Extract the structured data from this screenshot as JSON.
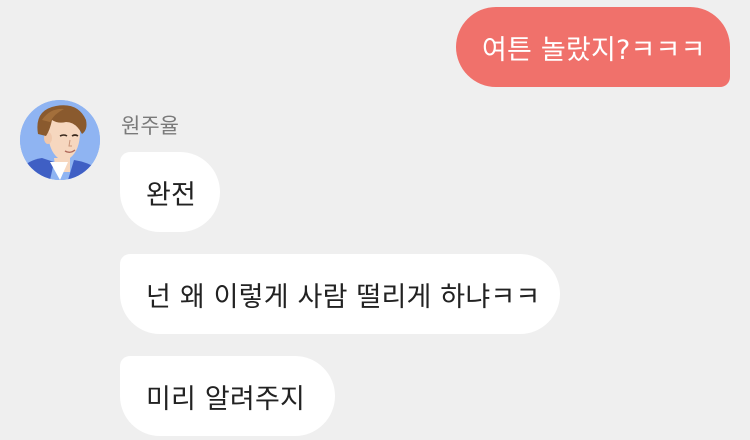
{
  "conversation": {
    "outgoing": [
      {
        "text": "여튼 놀랐지?ㅋㅋㅋ"
      }
    ],
    "incoming_sender": "원주율",
    "incoming": [
      {
        "text": "완전"
      },
      {
        "text": "넌 왜 이렇게 사람 떨리게 하냐ㅋㅋ"
      },
      {
        "text": "미리 알려주지"
      }
    ]
  },
  "colors": {
    "background": "#efefef",
    "outgoing_bubble": "#f0716b",
    "incoming_bubble": "#ffffff",
    "sender_name": "#7a7a7a",
    "avatar_background": "#8fb4f2"
  }
}
